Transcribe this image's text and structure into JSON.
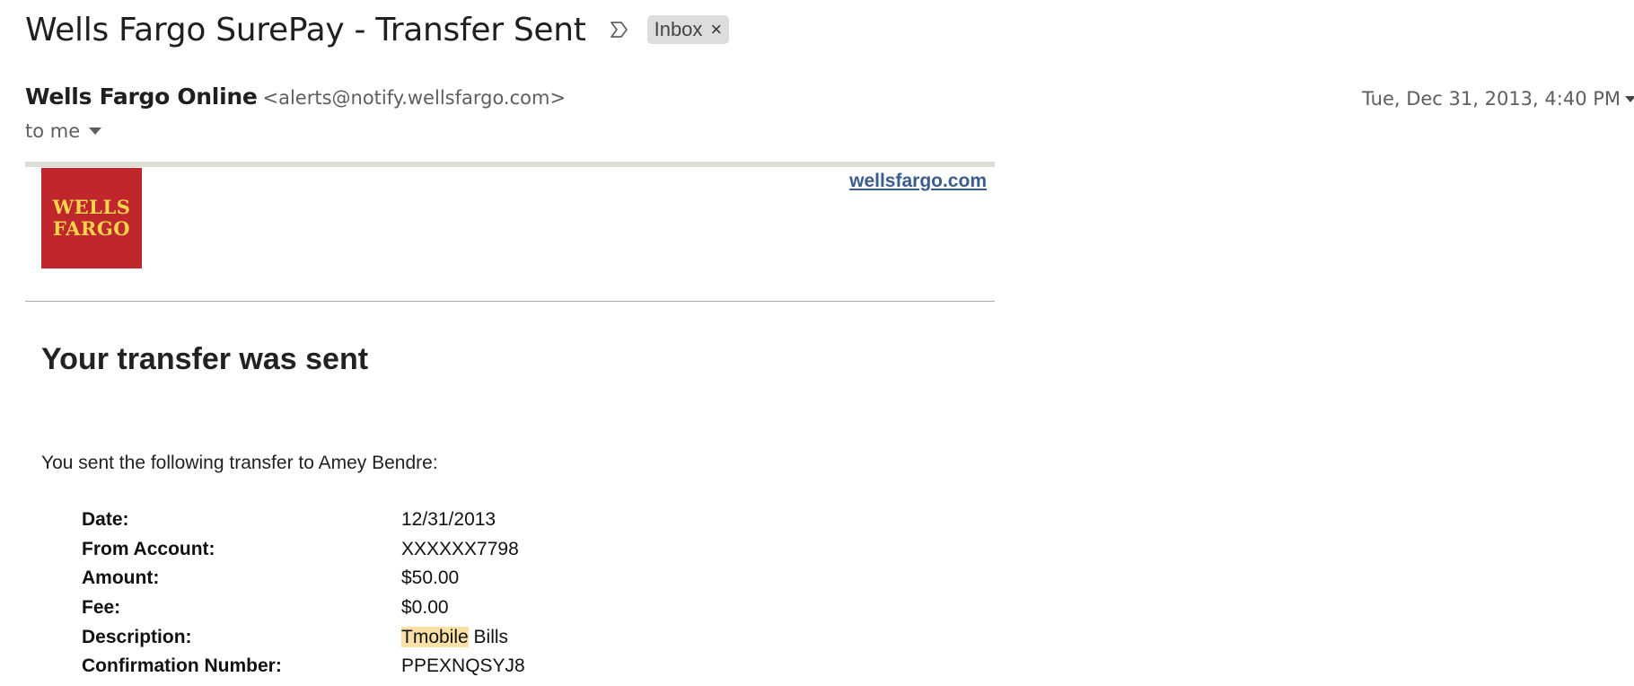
{
  "email": {
    "subject": "Wells Fargo SurePay - Transfer Sent",
    "label": {
      "name": "Inbox",
      "remove": "×"
    },
    "sender": {
      "name": "Wells Fargo Online",
      "email": "<alerts@notify.wellsfargo.com>"
    },
    "timestamp": "Tue, Dec 31, 2013, 4:40 PM",
    "recipient": "to me"
  },
  "icons": {
    "importance": "importance-marker-icon",
    "recipient_caret": "chevron-down-icon",
    "header_caret": "chevron-down-icon"
  },
  "body": {
    "logo": {
      "line1": "WELLS",
      "line2": "FARGO"
    },
    "site_link": "wellsfargo.com",
    "heading": "Your transfer was sent",
    "intro": "You sent the following transfer to Amey Bendre:",
    "details": [
      {
        "label": "Date:",
        "value": "12/31/2013"
      },
      {
        "label": "From Account:",
        "value": "XXXXXX7798"
      },
      {
        "label": "Amount:",
        "value": "$50.00"
      },
      {
        "label": "Fee:",
        "value": "$0.00"
      },
      {
        "label": "Description:",
        "value_highlight": "Tmobile",
        "value_rest": " Bills"
      },
      {
        "label": "Confirmation Number:",
        "value": "PPEXNQSYJ8"
      }
    ]
  },
  "colors": {
    "logo_bg": "#c0272d",
    "logo_text": "#f7d54a",
    "link": "#3a5d8f",
    "highlight": "#fbe1a6",
    "chip_bg": "#dddddd"
  }
}
